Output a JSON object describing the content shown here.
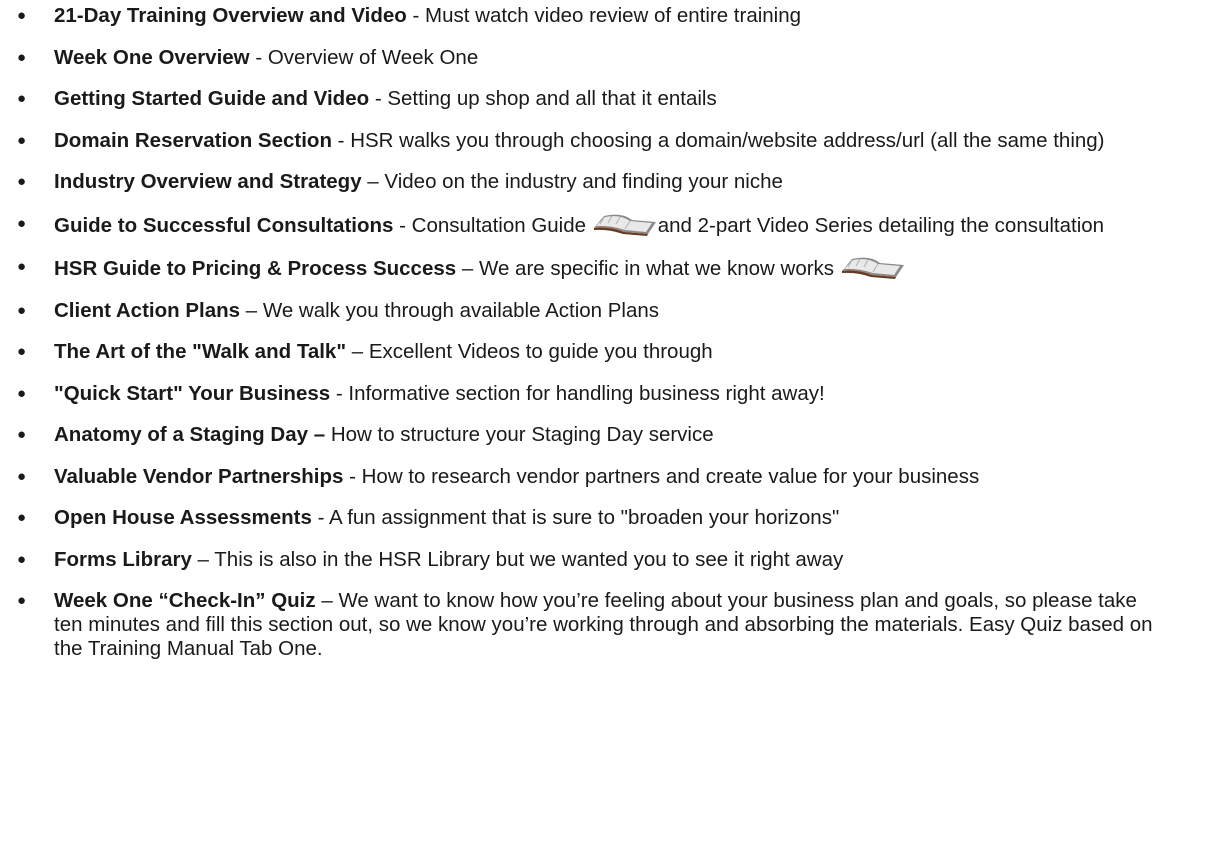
{
  "items": [
    {
      "title": "21-Day Training Overview and Video",
      "sep": " - ",
      "desc": "Must watch video review of entire training"
    },
    {
      "title": "Week One Overview",
      "sep": " - ",
      "desc": "Overview of Week One"
    },
    {
      "title": "Getting Started Guide and Video",
      "sep": " - ",
      "desc": "Setting up shop and all that it entails"
    },
    {
      "title": "Domain Reservation Section",
      "sep": " - ",
      "desc": "HSR walks you through choosing a domain/website address/url (all the same thing)"
    },
    {
      "title": "Industry Overview and Strategy",
      "sep": " – ",
      "desc": "Video on the industry and finding your niche"
    },
    {
      "title": "Guide to Successful Consultations",
      "sep": " - ",
      "desc_before": "Consultation Guide ",
      "icon": "open-book-icon",
      "desc_after": "and 2-part Video Series detailing the consultation"
    },
    {
      "title": "HSR Guide to Pricing & Process Success",
      "sep": " – ",
      "desc": "We are specific in what we know works ",
      "icon": "open-book-icon"
    },
    {
      "title": "Client Action Plans",
      "sep": " – ",
      "desc": "We walk you through available Action Plans"
    },
    {
      "title": "The Art of the \"Walk and Talk\"",
      "sep": " – ",
      "desc": "Excellent Videos to guide you through"
    },
    {
      "title": "\"Quick Start\" Your Business",
      "sep": " - ",
      "desc": "Informative section for handling business right away!"
    },
    {
      "title": "Anatomy of a Staging Day –",
      "sep": " ",
      "desc": "How to structure your Staging Day service"
    },
    {
      "title": "Valuable Vendor Partnerships",
      "sep": " - ",
      "desc": "How to research vendor partners and create value for your business"
    },
    {
      "title": "Open House Assessments",
      "sep": " - ",
      "desc": "A fun assignment that is sure to \"broaden your horizons\""
    },
    {
      "title": "Forms Library",
      "sep": " – ",
      "desc": "This is also in the HSR Library but we wanted you to see it right away"
    },
    {
      "title": "Week One “Check-In” Quiz",
      "sep": " – ",
      "desc": "We want to know how you’re feeling about your business plan and goals, so please take ten minutes and fill this section out, so we know you’re working through and absorbing the materials.  Easy Quiz based on the Training Manual Tab One."
    }
  ]
}
